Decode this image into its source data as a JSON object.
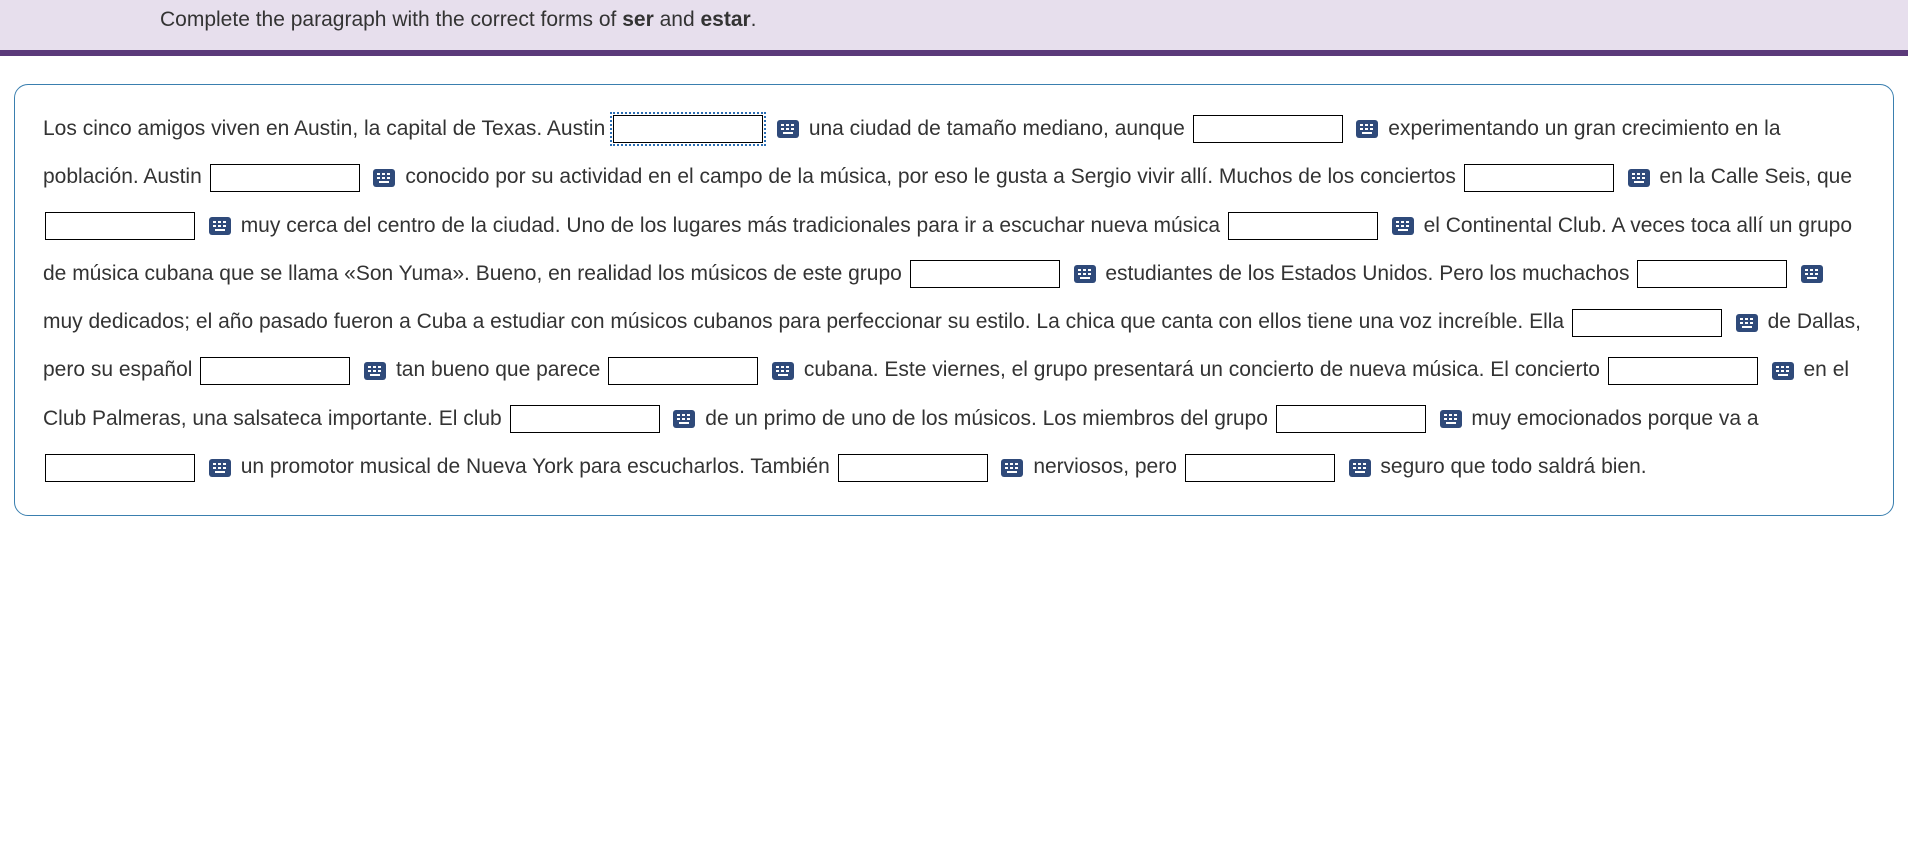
{
  "instruction": {
    "prefix": "Complete the paragraph with the correct forms of ",
    "term1": "ser",
    "mid": " and ",
    "term2": "estar",
    "suffix": "."
  },
  "paragraph": {
    "p01": "Los cinco amigos viven en Austin, la capital de Texas. Austin",
    "p02": " una ciudad de tamaño mediano, aunque ",
    "p03": " experimentando un gran crecimiento en la población. Austin ",
    "p04": " conocido por su actividad en el campo de la música, por eso le gusta a Sergio vivir allí. Muchos de los conciertos ",
    "p05": " en la Calle Seis, que ",
    "p06": " muy cerca del centro de la ciudad. Uno de los lugares más tradicionales para ir a escuchar nueva música ",
    "p07": " el Continental Club. A veces toca allí un grupo de música cubana que se llama «Son Yuma». Bueno, en realidad los músicos de este grupo ",
    "p08": " estudiantes de los Estados Unidos. Pero los muchachos ",
    "p09": " muy dedicados; el año pasado fueron a Cuba a estudiar con músicos cubanos para perfeccionar su estilo. La chica que canta con ellos tiene una voz increíble. Ella ",
    "p10": " de Dallas, pero su español ",
    "p11": " tan bueno que parece ",
    "p12": " cubana. Este viernes, el grupo presentará un concierto de nueva música. El concierto ",
    "p13": " en el Club Palmeras, una salsateca importante. El club ",
    "p14": " de un primo de uno de los músicos. Los miembros del grupo ",
    "p15": " muy emocionados porque va a ",
    "p16": " un promotor musical de Nueva York para escucharlos. También ",
    "p17": " nerviosos, pero ",
    "p18": " seguro que todo saldrá bien."
  }
}
